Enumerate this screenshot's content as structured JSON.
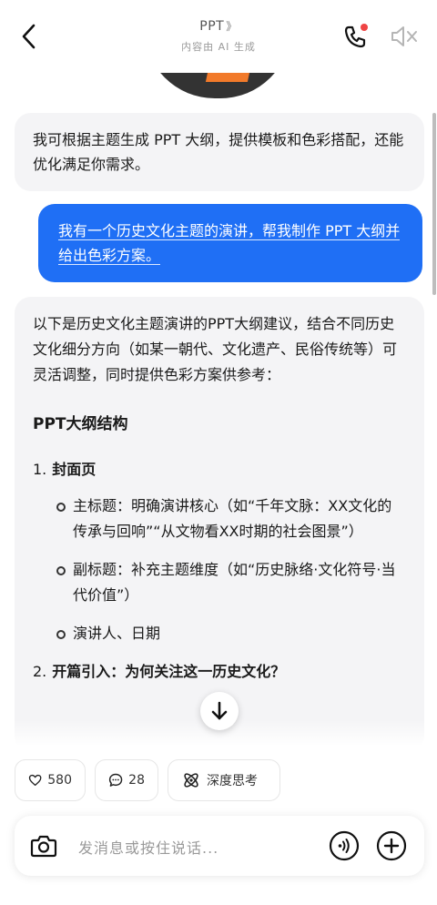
{
  "header": {
    "title": "PPT",
    "title_chevron": "》",
    "subtitle": "内容由 AI 生成"
  },
  "messages": {
    "bot_intro": "我可根据主题生成 PPT 大纲，提供模板和色彩搭配，还能优化满足你需求。",
    "user_request": "我有一个历史文化主题的演讲，帮我制作 PPT 大纲并给出色彩方案。",
    "reply": {
      "intro": "以下是历史文化主题演讲的PPT大纲建议，结合不同历史文化细分方向（如某一朝代、文化遗产、民俗传统等）可灵活调整，同时提供色彩方案供参考：",
      "heading": "PPT大纲结构",
      "section1_num": "1.",
      "section1_title": "封面页",
      "bullets": [
        "主标题：明确演讲核心（如“千年文脉：XX文化的传承与回响”“从文物看XX时期的社会图景”）",
        "副标题：补充主题维度（如“历史脉络·文化符号·当代价值”）",
        "演讲人、日期"
      ],
      "section2_num": "2.",
      "section2_title": "开篇引入：为何关注这一历史文化？"
    }
  },
  "actions": {
    "like_count": "580",
    "comment_count": "28",
    "deep_think_label": "深度思考"
  },
  "input": {
    "placeholder": "发消息或按住说话..."
  },
  "colors": {
    "accent": "#1f6ff5",
    "bot_bubble": "#f4f4f6",
    "notification_dot": "#ef4444"
  }
}
